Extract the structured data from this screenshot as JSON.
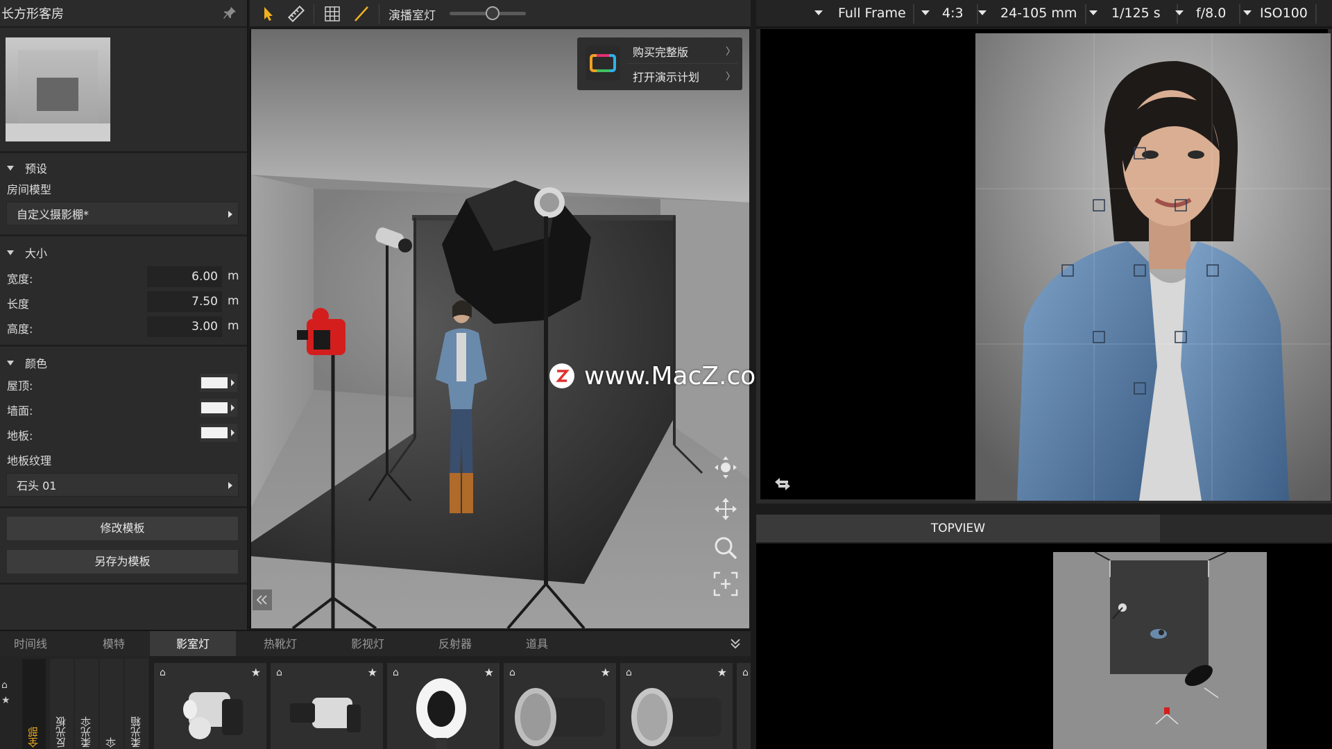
{
  "left_panel": {
    "title": "长方形客房",
    "preset_section": "预设",
    "room_model_label": "房间模型",
    "room_model_value": "自定义摄影棚*",
    "size_section": "大小",
    "width_label": "宽度:",
    "width_value": "6.00",
    "length_label": "长度",
    "length_value": "7.50",
    "height_label": "高度:",
    "height_value": "3.00",
    "unit": "m",
    "color_section": "颜色",
    "ceiling_label": "屋顶:",
    "wall_label": "墙面:",
    "floor_label": "地板:",
    "floor_texture_label": "地板纹理",
    "floor_texture_value": "石头 01",
    "edit_template_button": "修改模板",
    "save_template_button": "另存为模板"
  },
  "viewport_toolbar": {
    "light_label": "演播室灯"
  },
  "promo": {
    "buy_full": "购买完整版",
    "open_demo": "打开演示计划"
  },
  "watermark": {
    "text": "www.MacZ.com"
  },
  "library": {
    "tabs": [
      "时间线",
      "模特",
      "影室灯",
      "热靴灯",
      "影视灯",
      "反射器",
      "道具"
    ],
    "active_tab": "影室灯",
    "categories": [
      "全部",
      "反光板",
      "柔光伞",
      "伞",
      "柔光箱"
    ]
  },
  "camera_settings": {
    "sensor": "Full Frame",
    "aspect": "4:3",
    "lens": "24-105 mm",
    "shutter": "1/125 s",
    "aperture": "f/8.0",
    "iso": "ISO100"
  },
  "top_view": {
    "tab": "TOPVIEW"
  },
  "colors": {
    "accent": "#f0b020",
    "panel_bg": "#2b2b2b",
    "active_tab": "#3a3a3a"
  }
}
